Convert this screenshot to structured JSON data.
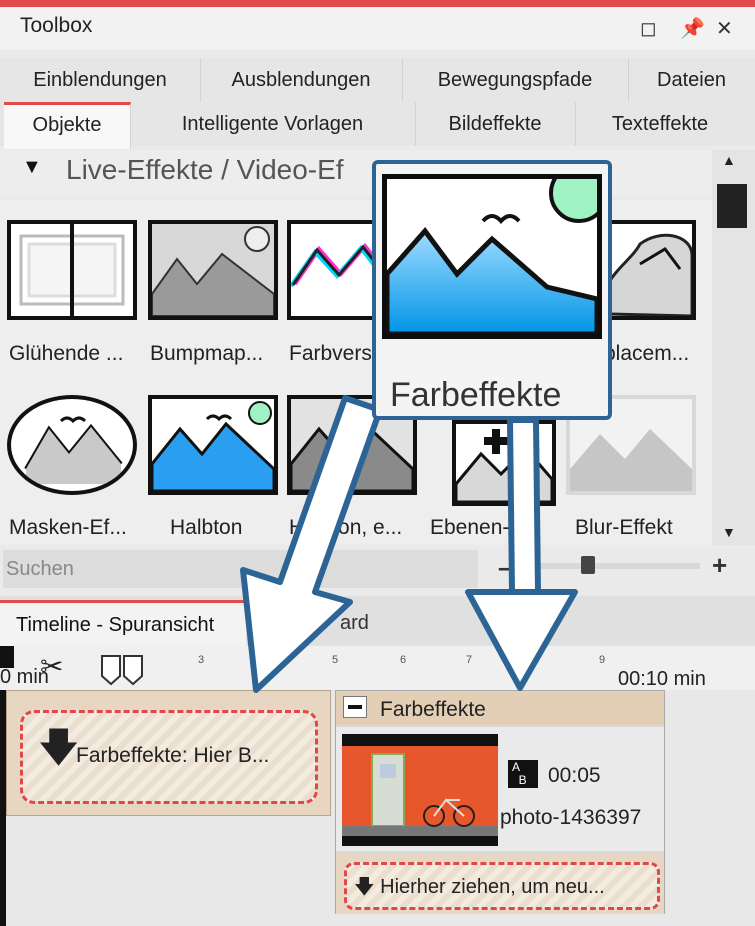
{
  "window": {
    "title": "Toolbox"
  },
  "tabs_row1": [
    {
      "label": "Einblendungen"
    },
    {
      "label": "Ausblendungen"
    },
    {
      "label": "Bewegungspfade"
    },
    {
      "label": "Dateien"
    }
  ],
  "tabs_row2": [
    {
      "label": "Objekte",
      "active": true
    },
    {
      "label": "Intelligente Vorlagen"
    },
    {
      "label": "Bildeffekte"
    },
    {
      "label": "Texteffekte"
    }
  ],
  "section": {
    "title": "Live-Effekte / Video-Ef"
  },
  "thumbnails": [
    {
      "label": "Glühende ...",
      "icon": "glow-effect-icon"
    },
    {
      "label": "Bumpmap...",
      "icon": "bumpmap-icon"
    },
    {
      "label": "Farbvers",
      "icon": "color-shift-icon"
    },
    {
      "label": "placem...",
      "icon": "displacement-icon"
    },
    {
      "label": "Masken-Ef...",
      "icon": "mask-effect-icon"
    },
    {
      "label": "Halbton",
      "icon": "halftone-icon"
    },
    {
      "label": "Halbton, e...",
      "icon": "halftone-bw-icon"
    },
    {
      "label": "Ebenen-...",
      "icon": "layers-icon"
    },
    {
      "label": "Blur-Effekt",
      "icon": "blur-effect-icon"
    }
  ],
  "search": {
    "placeholder": "Suchen"
  },
  "timeline": {
    "tab_label": "Timeline - Spuransicht",
    "tab2_label": "ard",
    "ruler_ticks": [
      "3",
      "5",
      "6",
      "7",
      "9"
    ],
    "time_left": "0 min",
    "time_right": "00:10 min",
    "dropzone_label": "Farbeffekte: Hier B..."
  },
  "effect_group": {
    "title": "Farbeffekte",
    "clip_duration": "00:05",
    "clip_name": "photo-1436397",
    "drop_hint": "Hierher ziehen, um neu..."
  },
  "overlay": {
    "label": "Farbeffekte"
  },
  "colors": {
    "accent": "#e34a4a",
    "overlay_border": "#2c6595",
    "drop_dash": "#e04848"
  }
}
